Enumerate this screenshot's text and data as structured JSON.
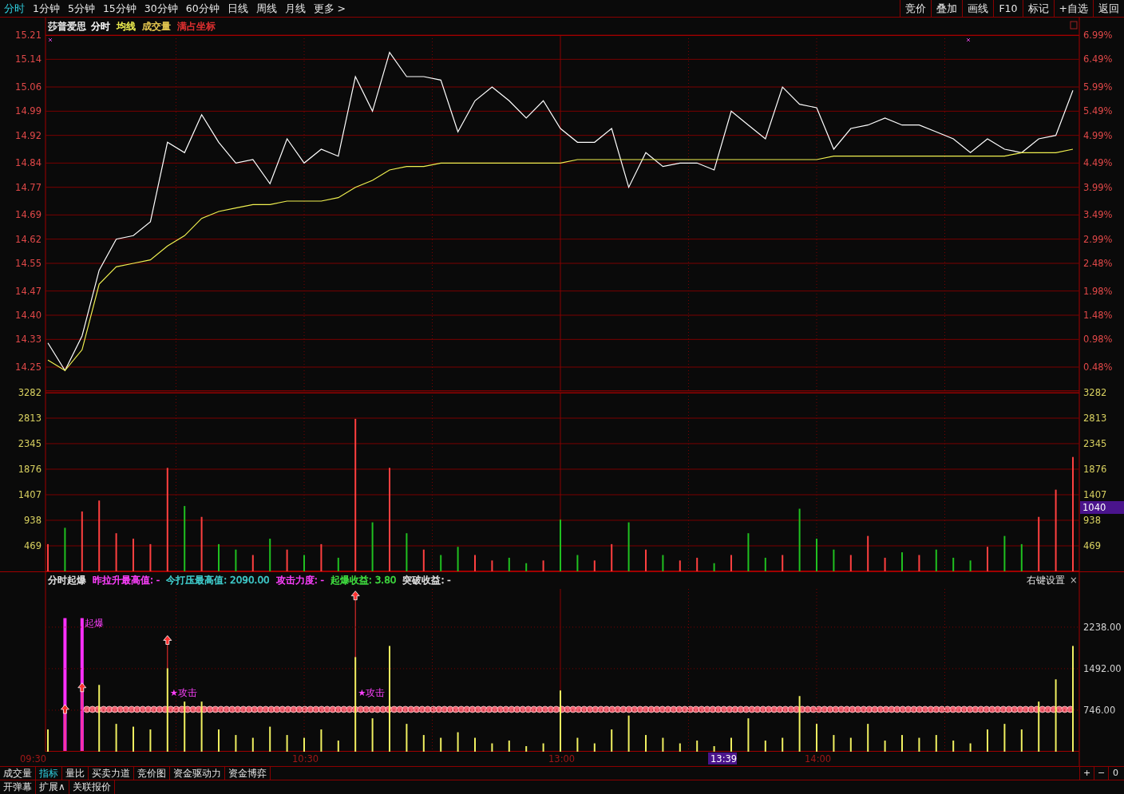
{
  "toolbar": {
    "periods": [
      {
        "label": "分时",
        "selected": true
      },
      {
        "label": "1分钟",
        "selected": false
      },
      {
        "label": "5分钟",
        "selected": false
      },
      {
        "label": "15分钟",
        "selected": false
      },
      {
        "label": "30分钟",
        "selected": false
      },
      {
        "label": "60分钟",
        "selected": false
      },
      {
        "label": "日线",
        "selected": false
      },
      {
        "label": "周线",
        "selected": false
      },
      {
        "label": "月线",
        "selected": false
      },
      {
        "label": "更多 >",
        "selected": false
      }
    ],
    "actions": [
      "竞价",
      "叠加",
      "画线",
      "F10",
      "标记",
      "+自选",
      "返回"
    ]
  },
  "price_panel": {
    "title": "莎普爱思",
    "legend": [
      {
        "text": "成交量",
        "color": "#e6c850"
      },
      {
        "text": "满占坐标",
        "color": "#e03030"
      }
    ],
    "right_ticks": [
      "6.99%",
      "6.49%",
      "5.99%",
      "5.49%",
      "4.99%",
      "4.49%",
      "3.99%",
      "3.49%",
      "2.99%",
      "2.48%",
      "1.98%",
      "1.48%",
      "0.98%",
      "0.48%"
    ],
    "chart_data": {
      "type": "line",
      "grid": true,
      "ylim": [
        14.18,
        15.21
      ],
      "yticks": [
        {
          "value": 15.21,
          "label": "15.21"
        },
        {
          "value": 15.14,
          "label": "15.14"
        },
        {
          "value": 15.06,
          "label": "15.06"
        },
        {
          "value": 14.99,
          "label": "14.99"
        },
        {
          "value": 14.92,
          "label": "14.92"
        },
        {
          "value": 14.84,
          "label": "14.84"
        },
        {
          "value": 14.77,
          "label": "14.77"
        },
        {
          "value": 14.69,
          "label": "14.69"
        },
        {
          "value": 14.62,
          "label": "14.62"
        },
        {
          "value": 14.55,
          "label": "14.55"
        },
        {
          "value": 14.47,
          "label": "14.47"
        },
        {
          "value": 14.4,
          "label": "14.40"
        },
        {
          "value": 14.33,
          "label": "14.33"
        },
        {
          "value": 14.25,
          "label": "14.25"
        }
      ],
      "series": [
        {
          "name": "分时",
          "color": "#ffffff",
          "values": [
            14.32,
            14.24,
            14.34,
            14.53,
            14.62,
            14.63,
            14.67,
            14.9,
            14.87,
            14.98,
            14.9,
            14.84,
            14.85,
            14.78,
            14.91,
            14.84,
            14.88,
            14.86,
            15.09,
            14.99,
            15.16,
            15.09,
            15.09,
            15.08,
            14.93,
            15.02,
            15.06,
            15.02,
            14.97,
            15.02,
            14.94,
            14.9,
            14.9,
            14.94,
            14.77,
            14.87,
            14.83,
            14.84,
            14.84,
            14.82,
            14.99,
            14.95,
            14.91,
            15.06,
            15.01,
            15.0,
            14.88,
            14.94,
            14.95,
            14.97,
            14.95,
            14.95,
            14.93,
            14.91,
            14.87,
            14.91,
            14.88,
            14.87,
            14.91,
            14.92,
            15.05
          ]
        },
        {
          "name": "均线",
          "color": "#f0f050",
          "values": [
            14.27,
            14.24,
            14.3,
            14.49,
            14.54,
            14.55,
            14.56,
            14.6,
            14.63,
            14.68,
            14.7,
            14.71,
            14.72,
            14.72,
            14.73,
            14.73,
            14.73,
            14.74,
            14.77,
            14.79,
            14.82,
            14.83,
            14.83,
            14.84,
            14.84,
            14.84,
            14.84,
            14.84,
            14.84,
            14.84,
            14.84,
            14.85,
            14.85,
            14.85,
            14.85,
            14.85,
            14.85,
            14.85,
            14.85,
            14.85,
            14.85,
            14.85,
            14.85,
            14.85,
            14.85,
            14.85,
            14.86,
            14.86,
            14.86,
            14.86,
            14.86,
            14.86,
            14.86,
            14.86,
            14.86,
            14.86,
            14.86,
            14.87,
            14.87,
            14.87,
            14.88
          ]
        }
      ]
    }
  },
  "volume_panel": {
    "cursor_value": "1040",
    "chart_data": {
      "type": "bar",
      "stacked": true,
      "grid": true,
      "ylim": [
        0,
        3282
      ],
      "yticks": [
        {
          "value": 3282,
          "label": "3282"
        },
        {
          "value": 2813,
          "label": "2813"
        },
        {
          "value": 2345,
          "label": "2345"
        },
        {
          "value": 1876,
          "label": "1876"
        },
        {
          "value": 1407,
          "label": "1407"
        },
        {
          "value": 938,
          "label": "938"
        },
        {
          "value": 469,
          "label": "469"
        }
      ],
      "series": [
        {
          "color": "#ff4040",
          "values": [
            500,
            null,
            1100,
            1300,
            700,
            600,
            500,
            1900,
            null,
            1000,
            null,
            null,
            300,
            null,
            400,
            null,
            500,
            null,
            2800,
            null,
            1900,
            null,
            400,
            null,
            null,
            300,
            200,
            null,
            null,
            200,
            null,
            null,
            200,
            500,
            null,
            400,
            null,
            200,
            250,
            null,
            300,
            null,
            null,
            300,
            null,
            null,
            null,
            300,
            650,
            250,
            null,
            300,
            null,
            null,
            null,
            450,
            null,
            null,
            1000,
            1500,
            2100
          ]
        },
        {
          "color": "#20c020",
          "values": [
            null,
            800,
            null,
            null,
            null,
            null,
            null,
            null,
            1200,
            null,
            500,
            400,
            null,
            600,
            null,
            300,
            null,
            250,
            null,
            900,
            null,
            700,
            null,
            300,
            450,
            null,
            null,
            250,
            150,
            null,
            950,
            300,
            null,
            null,
            900,
            null,
            300,
            null,
            null,
            150,
            null,
            700,
            250,
            null,
            1150,
            600,
            400,
            null,
            null,
            null,
            350,
            null,
            400,
            250,
            200,
            null,
            650,
            500,
            null,
            null,
            null
          ]
        }
      ]
    }
  },
  "indicator_panel": {
    "title": "分时起爆",
    "legend": [
      {
        "text": "昨拉升最高值: -",
        "color": "#ff40ff"
      },
      {
        "text": "今打压最高值: 2090.00",
        "color": "#40d0d0"
      },
      {
        "text": "攻击力度: -",
        "color": "#ff40ff"
      },
      {
        "text": "起爆收益: 3.80",
        "color": "#40e040"
      },
      {
        "text": "突破收益: -",
        "color": "#e0e0e0"
      }
    ],
    "settings_label": "右键设置",
    "close_label": "×",
    "chart_data": {
      "type": "bar",
      "grid": true,
      "ylim": [
        0,
        3240
      ],
      "yticks": [
        {
          "value": 2238,
          "label": "2238.00"
        },
        {
          "value": 1492,
          "label": "1492.00"
        },
        {
          "value": 746,
          "label": "746.00"
        }
      ],
      "series": [
        {
          "color": "#f0f060",
          "values": [
            400,
            null,
            null,
            1200,
            500,
            450,
            400,
            1500,
            900,
            900,
            400,
            300,
            250,
            450,
            300,
            250,
            400,
            200,
            1700,
            600,
            1900,
            500,
            300,
            250,
            350,
            250,
            150,
            200,
            100,
            150,
            1100,
            250,
            150,
            400,
            650,
            300,
            250,
            150,
            200,
            100,
            250,
            600,
            200,
            250,
            1000,
            500,
            300,
            250,
            500,
            200,
            300,
            250,
            300,
            200,
            150,
            400,
            500,
            400,
            900,
            1300,
            1900
          ]
        }
      ]
    },
    "signals": [
      {
        "kind": "spike"
      },
      {
        "kind": "spike"
      },
      {
        "kind": "label",
        "text": "起爆"
      },
      {
        "kind": "beads"
      },
      {
        "kind": "arrow"
      },
      {
        "kind": "arrow"
      },
      {
        "kind": "arrow"
      },
      {
        "kind": "arrow"
      },
      {
        "kind": "label",
        "text": "★攻击"
      },
      {
        "kind": "label",
        "text": "★攻击"
      }
    ]
  },
  "time_axis": {
    "labels": [
      "09:30",
      "10:30",
      "13:00",
      "14:00"
    ],
    "cursor_time": "13:39"
  },
  "bottom_tabs": [
    {
      "label": "成交量",
      "selected": false
    },
    {
      "label": "指标",
      "selected": true
    },
    {
      "label": "量比",
      "selected": false
    },
    {
      "label": "买卖力道",
      "selected": false
    },
    {
      "label": "竞价图",
      "selected": false
    },
    {
      "label": "资金驱动力",
      "selected": false
    },
    {
      "label": "资金博弈",
      "selected": false
    }
  ],
  "zoom_buttons": [
    "+",
    "−",
    "0"
  ],
  "extra_tabs": [
    "开弹幕",
    "扩展∧",
    "关联报价"
  ]
}
